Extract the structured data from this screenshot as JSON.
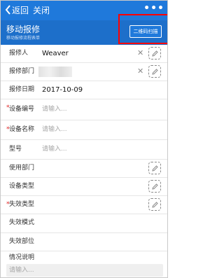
{
  "nav": {
    "back_label": "返回",
    "close_label": "关闭",
    "more_label": "•••"
  },
  "header": {
    "title": "移动报修",
    "subtitle": "移动报修流程表单",
    "scan_button_label": "二维码扫描"
  },
  "form": {
    "rows": [
      {
        "label": "报修人",
        "value": "Weaver",
        "required": false,
        "placeholder": ""
      },
      {
        "label": "报修部门",
        "value": "",
        "required": false,
        "placeholder": ""
      },
      {
        "label": "报修日期",
        "value": "2017-10-09",
        "required": false,
        "placeholder": ""
      },
      {
        "label": "设备编号",
        "value": "",
        "required": true,
        "placeholder": "请输入..."
      },
      {
        "label": "设备名称",
        "value": "",
        "required": true,
        "placeholder": "请输入..."
      },
      {
        "label": "型号",
        "value": "",
        "required": false,
        "placeholder": "请输入..."
      },
      {
        "label": "使用部门",
        "value": "",
        "required": false,
        "placeholder": ""
      },
      {
        "label": "设备类型",
        "value": "",
        "required": false,
        "placeholder": ""
      },
      {
        "label": "失效类型",
        "value": "",
        "required": true,
        "placeholder": ""
      },
      {
        "label": "失效模式",
        "value": "",
        "required": false,
        "placeholder": ""
      },
      {
        "label": "失效部位",
        "value": "",
        "required": false,
        "placeholder": ""
      }
    ],
    "required_mark": "*",
    "clear_glyph": "✕",
    "description": {
      "label": "情况说明",
      "placeholder": "请输入..."
    }
  },
  "colors": {
    "nav_bg": "#1f79db",
    "header_bg": "#1d6fca",
    "highlight": "#ff0000",
    "required": "#e02020"
  },
  "icons": {
    "back": "chevron-left-icon",
    "clear": "close-icon",
    "edit": "pencil-icon",
    "more": "more-icon"
  }
}
